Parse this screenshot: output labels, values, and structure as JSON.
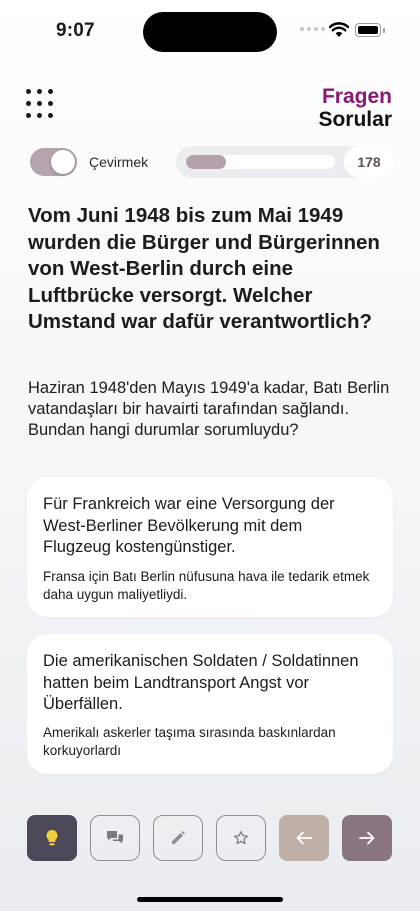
{
  "status_bar": {
    "time": "9:07",
    "icons": [
      "cellular-signal-icon",
      "wifi-icon",
      "battery-icon"
    ]
  },
  "header": {
    "menu_icon": "grid-menu-icon",
    "title_de": "Fragen",
    "title_tr": "Sorular",
    "title_de_color": "#8a1a6f"
  },
  "controls": {
    "translate_toggle_label": "Çevirmek",
    "translate_toggle_on": true,
    "progress_fraction": 0.27,
    "question_count": "178"
  },
  "question": {
    "de": "Vom Juni 1948 bis zum Mai 1949 wurden die Bürger und Bürgerinnen von West-Berlin durch eine Luftbrücke versorgt. Welcher Umstand war dafür verantwortlich?",
    "tr": "Haziran 1948'den Mayıs 1949'a kadar, Batı Berlin vatandaşları bir havairti tarafından sağlandı. Bundan hangi durumlar sorumluydu?"
  },
  "answers": [
    {
      "de": "Für Frankreich war eine Versorgung der West-Berliner Bevölkerung mit dem Flugzeug kostengünstiger.",
      "tr": "Fransa için Batı Berlin nüfusuna hava ile tedarik etmek daha uygun maliyetliydi."
    },
    {
      "de": "Die amerikanischen Soldaten / Soldatinnen hatten beim Landtransport Angst vor Überfällen.",
      "tr": "Amerikalı askerler taşıma sırasında baskınlardan korkuyorlardı"
    }
  ],
  "toolbar": {
    "buttons": [
      {
        "name": "hint",
        "icon": "lightbulb-icon"
      },
      {
        "name": "comment",
        "icon": "chat-bubbles-icon"
      },
      {
        "name": "edit",
        "icon": "pencil-icon"
      },
      {
        "name": "favorite",
        "icon": "star-icon"
      },
      {
        "name": "previous",
        "icon": "arrow-left-icon"
      },
      {
        "name": "next",
        "icon": "arrow-right-icon"
      }
    ],
    "colors": {
      "hint": "#4c4857",
      "previous": "#bfb0a7",
      "next": "#897482",
      "lightbulb": "#f2d03b"
    }
  }
}
